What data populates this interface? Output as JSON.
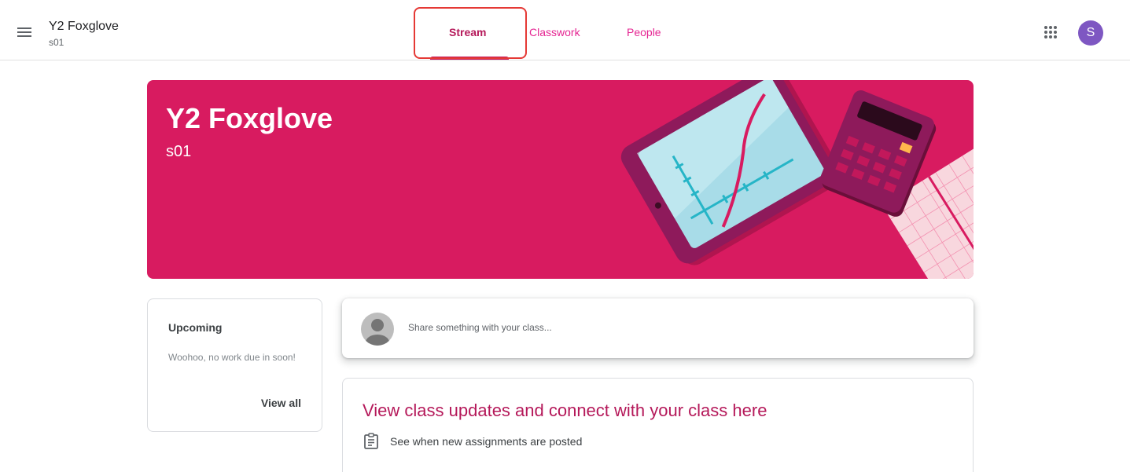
{
  "header": {
    "class_name": "Y2 Foxglove",
    "section": "s01",
    "avatar_letter": "S"
  },
  "tabs": [
    {
      "label": "Stream",
      "active": true
    },
    {
      "label": "Classwork",
      "active": false
    },
    {
      "label": "People",
      "active": false
    }
  ],
  "banner": {
    "title": "Y2 Foxglove",
    "subtitle": "s01",
    "color": "#d81b60"
  },
  "upcoming": {
    "title": "Upcoming",
    "message": "Woohoo, no work due in soon!",
    "view_all": "View all"
  },
  "share": {
    "placeholder": "Share something with your class..."
  },
  "updates": {
    "title": "View class updates and connect with your class here",
    "items": [
      {
        "icon": "assignment-icon",
        "text": "See when new assignments are posted"
      }
    ]
  },
  "colors": {
    "accent": "#b5195a",
    "tab_inactive": "#e52592",
    "avatar": "#7e57c2",
    "highlight": "#e53935"
  }
}
